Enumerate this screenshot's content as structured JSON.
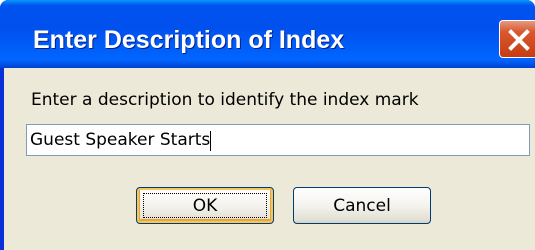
{
  "dialog": {
    "title": "Enter Description of Index",
    "prompt": "Enter a description to identify the index mark",
    "input_value": "Guest Speaker Starts",
    "ok_label": "OK",
    "cancel_label": "Cancel",
    "close_icon": "close-icon"
  },
  "colors": {
    "titlebar": "#0054e3",
    "close_button": "#d9582f",
    "dialog_background": "#ece9d8",
    "input_border": "#7f9db9",
    "button_border": "#003c74",
    "default_button_highlight": "#f6c65a"
  }
}
